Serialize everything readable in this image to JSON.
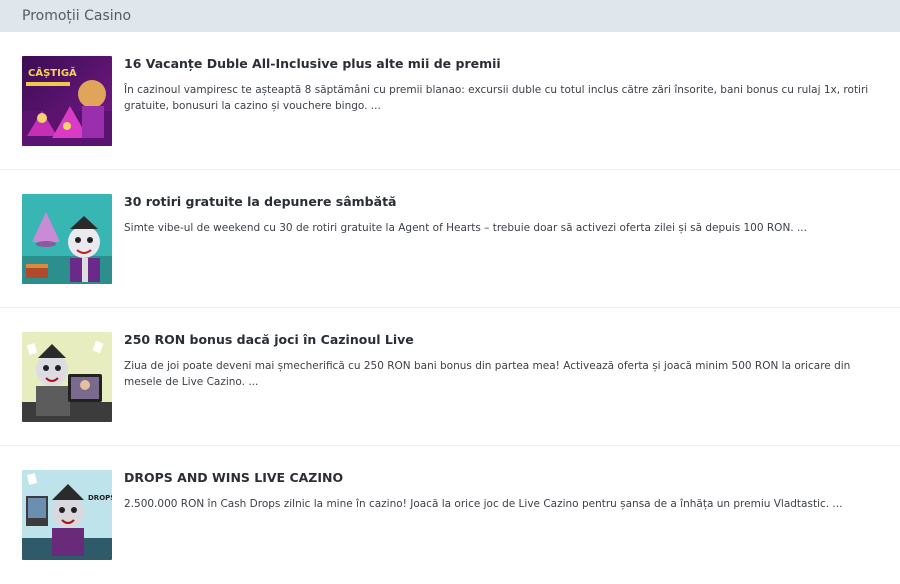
{
  "header": {
    "title": "Promoții Casino"
  },
  "promotions": [
    {
      "title": "16 Vacanțe Duble All-Inclusive plus alte mii de premii",
      "description": "În cazinoul vampiresc te așteaptă 8 săptămâni cu premii blanao: excursii duble cu totul inclus către zări însorite, bani bonus cu rulaj 1x, rotiri gratuite, bonusuri la cazino și vouchere bingo. ...",
      "image_text": "CÂȘTIGĂ"
    },
    {
      "title": "30 rotiri gratuite la depunere sâmbătă",
      "description": "Simte vibe-ul de weekend cu 30 de rotiri gratuite la Agent of Hearts – trebuie doar să activezi oferta zilei și să depuis 100 RON. ..."
    },
    {
      "title": "250 RON bonus dacă joci în Cazinoul Live",
      "description": "Ziua de joi poate deveni mai șmecherifică cu 250 RON bani bonus din partea mea! Activează oferta și joacă minim 500 RON la oricare din mesele de Live Cazino. ..."
    },
    {
      "title": "DROPS AND WINS LIVE CAZINO",
      "description": "2.500.000 RON în Cash Drops zilnic la mine în cazino! Joacă la orice joc de Live Cazino pentru șansa de a înhăța un premiu Vladtastic. ...",
      "image_text": "DROPS & WINS"
    }
  ]
}
